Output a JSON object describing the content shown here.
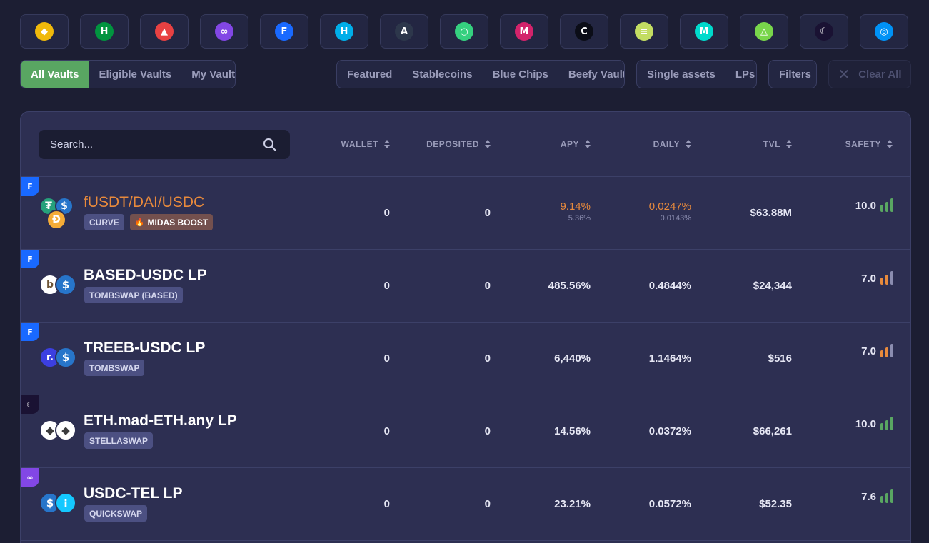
{
  "chains": [
    {
      "name": "bsc",
      "icon": "bnb-icon",
      "color": "#f0b90b",
      "glyph": "◆"
    },
    {
      "name": "heco",
      "icon": "heco-icon",
      "color": "#01943f",
      "glyph": "H"
    },
    {
      "name": "avax",
      "icon": "avalanche-icon",
      "color": "#e84142",
      "glyph": "▲"
    },
    {
      "name": "polygon",
      "icon": "polygon-icon",
      "color": "#8247e5",
      "glyph": "∞"
    },
    {
      "name": "fantom",
      "icon": "fantom-icon",
      "color": "#1969ff",
      "glyph": "F"
    },
    {
      "name": "harmony",
      "icon": "harmony-icon",
      "color": "#00aee9",
      "glyph": "H"
    },
    {
      "name": "arbitrum",
      "icon": "arbitrum-icon",
      "color": "#2d374b",
      "glyph": "A"
    },
    {
      "name": "celo",
      "icon": "celo-icon",
      "color": "#35d07f",
      "glyph": "○"
    },
    {
      "name": "moonriver",
      "icon": "moonriver-icon",
      "color": "#d3236b",
      "glyph": "M"
    },
    {
      "name": "cronos",
      "icon": "cronos-icon",
      "color": "#0b0d17",
      "glyph": "C"
    },
    {
      "name": "fuse",
      "icon": "fuse-icon",
      "color": "#c3dd62",
      "glyph": "≡"
    },
    {
      "name": "metis",
      "icon": "metis-icon",
      "color": "#00dacc",
      "glyph": "M"
    },
    {
      "name": "aurora",
      "icon": "aurora-icon",
      "color": "#78d64b",
      "glyph": "△"
    },
    {
      "name": "moonbeam",
      "icon": "moonbeam-icon",
      "color": "#1a1233",
      "glyph": "☾"
    },
    {
      "name": "emerald",
      "icon": "emerald-icon",
      "color": "#0092f6",
      "glyph": "◎"
    }
  ],
  "filters": {
    "vault_tabs": [
      "All Vaults",
      "Eligible Vaults",
      "My Vaults"
    ],
    "categories": [
      "Featured",
      "Stablecoins",
      "Blue Chips",
      "Beefy Vaults"
    ],
    "asset_types": [
      "Single assets",
      "LPs"
    ],
    "filters_label": "Filters",
    "clear_label": "Clear All"
  },
  "search": {
    "placeholder": "Search..."
  },
  "columns": [
    "WALLET",
    "DEPOSITED",
    "APY",
    "DAILY",
    "TVL",
    "SAFETY"
  ],
  "colors": {
    "accent_green": "#59a662",
    "featured_orange": "#e88a3c",
    "panel": "#2d2f52",
    "bg": "#1c1e33",
    "bar_green": "#59a662",
    "bar_orange": "#e88a3c",
    "bar_grey": "#8b8db0"
  },
  "vaults": [
    {
      "name": "fUSDT/DAI/USDC",
      "featured": true,
      "chain": "fantom",
      "tags": [
        {
          "label": "CURVE"
        },
        {
          "label": "MIDAS BOOST",
          "boost": true
        }
      ],
      "wallet": "0",
      "deposited": "0",
      "apy": "9.14%",
      "apy_old": "5.36%",
      "daily": "0.0247%",
      "daily_old": "0.0143%",
      "tvl": "$63.88M",
      "safety": "10.0",
      "safety_level": 3
    },
    {
      "name": "BASED-USDC LP",
      "featured": false,
      "chain": "fantom",
      "tags": [
        {
          "label": "TOMBSWAP (BASED)"
        }
      ],
      "wallet": "0",
      "deposited": "0",
      "apy": "485.56%",
      "daily": "0.4844%",
      "tvl": "$24,344",
      "safety": "7.0",
      "safety_level": 2
    },
    {
      "name": "TREEB-USDC LP",
      "featured": false,
      "chain": "fantom",
      "tags": [
        {
          "label": "TOMBSWAP"
        }
      ],
      "wallet": "0",
      "deposited": "0",
      "apy": "6,440%",
      "daily": "1.1464%",
      "tvl": "$516",
      "safety": "7.0",
      "safety_level": 2
    },
    {
      "name": "ETH.mad-ETH.any LP",
      "featured": false,
      "chain": "moonbeam",
      "tags": [
        {
          "label": "STELLASWAP"
        }
      ],
      "wallet": "0",
      "deposited": "0",
      "apy": "14.56%",
      "daily": "0.0372%",
      "tvl": "$66,261",
      "safety": "10.0",
      "safety_level": 3
    },
    {
      "name": "USDC-TEL LP",
      "featured": false,
      "chain": "polygon",
      "tags": [
        {
          "label": "QUICKSWAP"
        }
      ],
      "wallet": "0",
      "deposited": "0",
      "apy": "23.21%",
      "daily": "0.0572%",
      "tvl": "$52.35",
      "safety": "7.6",
      "safety_level": 3
    }
  ]
}
